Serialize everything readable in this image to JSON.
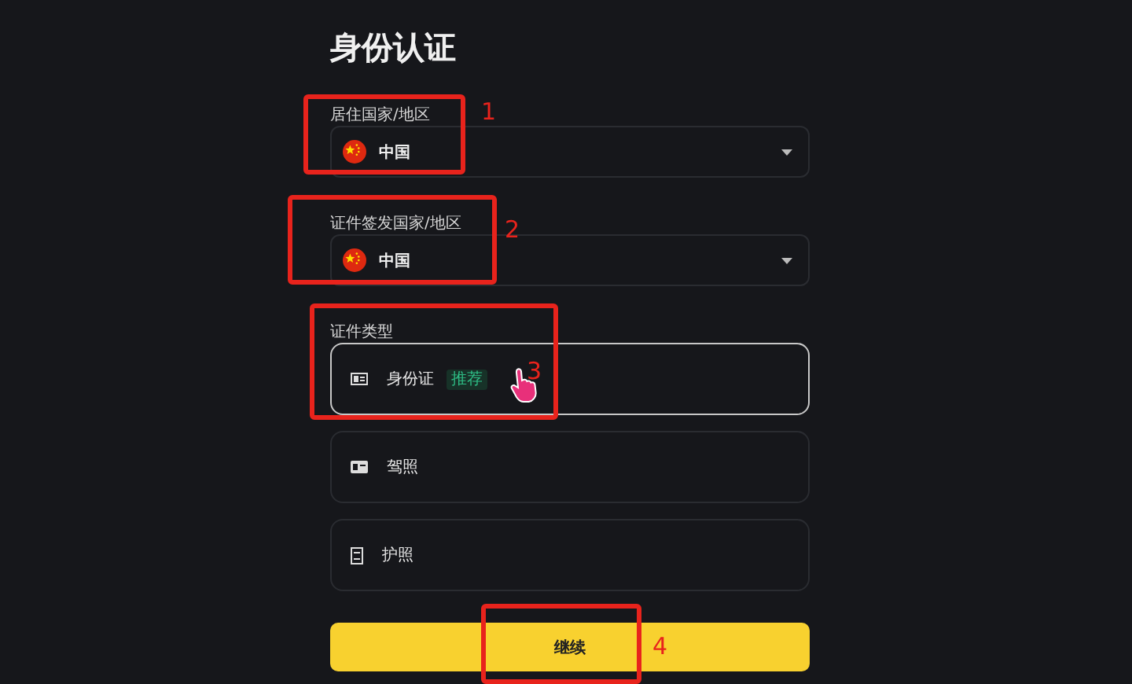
{
  "title": "身份认证",
  "selects": [
    {
      "label": "居住国家/地区",
      "value": "中国"
    },
    {
      "label": "证件签发国家/地区",
      "value": "中国"
    }
  ],
  "document_type": {
    "label": "证件类型",
    "options": [
      {
        "kind": "id-card",
        "label": "身份证",
        "badge": "推荐",
        "selected": true
      },
      {
        "kind": "license",
        "label": "驾照",
        "selected": false
      },
      {
        "kind": "passport",
        "label": "护照",
        "selected": false
      }
    ]
  },
  "continue_button": "继续",
  "annotations": [
    {
      "number": "1"
    },
    {
      "number": "2"
    },
    {
      "number": "3"
    },
    {
      "number": "4"
    }
  ]
}
